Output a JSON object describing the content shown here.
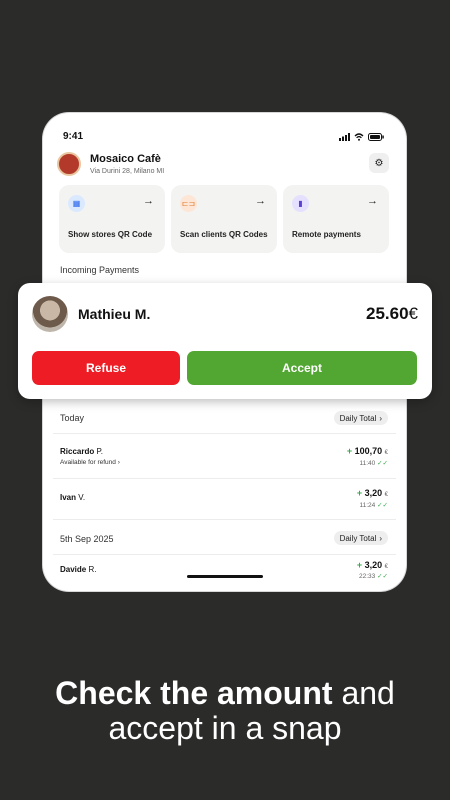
{
  "status": {
    "time": "9:41"
  },
  "store": {
    "name": "Mosaico Cafè",
    "address": "Via Durini 28, Milano MI"
  },
  "actions": [
    {
      "label": "Show stores QR Code",
      "icon": "qr-code-icon",
      "color": "#dbe9ff"
    },
    {
      "label": "Scan clients QR Codes",
      "icon": "scan-icon",
      "color": "#fde6d6"
    },
    {
      "label": "Remote payments",
      "icon": "phone-icon",
      "color": "#e6e0ff"
    }
  ],
  "incoming_label": "Incoming Payments",
  "payment_request": {
    "name": "Mathieu M.",
    "amount": "25.60",
    "currency": "€",
    "refuse_label": "Refuse",
    "accept_label": "Accept"
  },
  "sections": [
    {
      "title": "Today",
      "daily_label": "Daily Total",
      "transactions": [
        {
          "first": "Riccardo",
          "initial": "P.",
          "sub": "Available for refund",
          "amount": "100,70",
          "time": "11:40"
        },
        {
          "first": "Ivan",
          "initial": "V.",
          "sub": "",
          "amount": "3,20",
          "time": "11:24"
        }
      ]
    },
    {
      "title": "5th Sep 2025",
      "daily_label": "Daily Total",
      "transactions": [
        {
          "first": "Davide",
          "initial": "R.",
          "sub": "",
          "amount": "3,20",
          "time": "22:33"
        }
      ]
    }
  ],
  "caption": {
    "bold": "Check the amount",
    "rest1": " and",
    "line2": "accept in a snap"
  }
}
